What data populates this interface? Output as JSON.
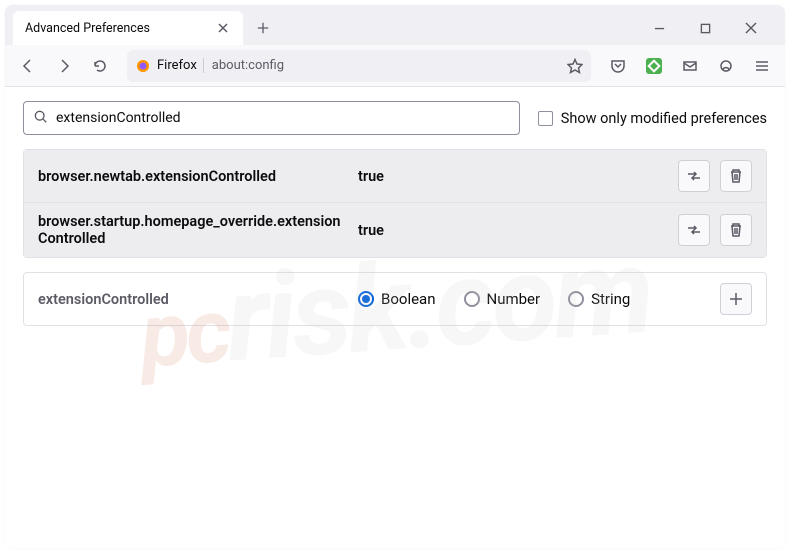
{
  "tab": {
    "title": "Advanced Preferences"
  },
  "urlbar": {
    "identity": "Firefox",
    "url": "about:config"
  },
  "search": {
    "value": "extensionControlled",
    "checkbox_label": "Show only modified preferences"
  },
  "prefs": {
    "rows": [
      {
        "name": "browser.newtab.extensionControlled",
        "value": "true"
      },
      {
        "name": "browser.startup.homepage_override.extensionControlled",
        "value": "true"
      }
    ]
  },
  "new_pref": {
    "name": "extensionControlled",
    "types": {
      "boolean": "Boolean",
      "number": "Number",
      "string": "String"
    }
  }
}
